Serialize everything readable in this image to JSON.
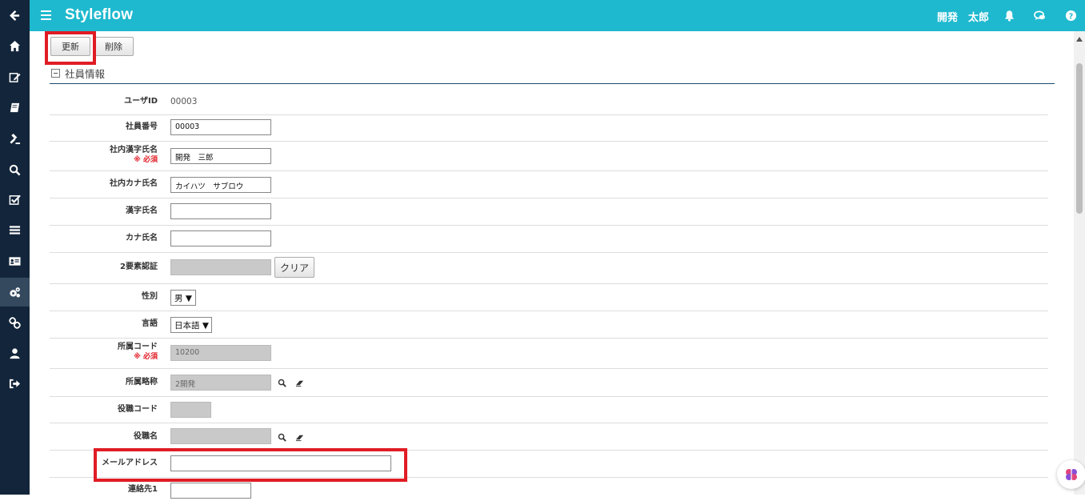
{
  "app": {
    "title": "Styleflow",
    "user_name": "開発　太郎"
  },
  "sidebar": {
    "icons": [
      "back-arrow-icon",
      "home-icon",
      "edit-icon",
      "book-icon",
      "gavel-icon",
      "search-icon",
      "check-icon",
      "list-icon",
      "id-card-icon",
      "gears-icon",
      "link-icon",
      "user-icon",
      "sign-out-icon"
    ],
    "active": "gears-icon"
  },
  "header": {
    "icons": [
      "bell-icon",
      "chat-icon",
      "help-icon"
    ]
  },
  "toolbar": {
    "update_label": "更新",
    "delete_label": "削除"
  },
  "section": {
    "title": "社員情報"
  },
  "form": {
    "user_id": {
      "label": "ユーザID",
      "value": "00003"
    },
    "employee_no": {
      "label": "社員番号",
      "value": "00003"
    },
    "kanji_name_internal": {
      "label": "社内漢字氏名",
      "required": "※ 必須",
      "value": "開発　三郎"
    },
    "kana_name_internal": {
      "label": "社内カナ氏名",
      "value": "カイハツ　サブロウ"
    },
    "kanji_name": {
      "label": "漢字氏名",
      "value": ""
    },
    "kana_name": {
      "label": "カナ氏名",
      "value": ""
    },
    "two_factor": {
      "label": "2要素認証",
      "value": "",
      "clear_label": "クリア"
    },
    "gender": {
      "label": "性別",
      "value": "男"
    },
    "language": {
      "label": "言語",
      "value": "日本語"
    },
    "dept_code": {
      "label": "所属コード",
      "required": "※ 必須",
      "value": "10200"
    },
    "dept_short": {
      "label": "所属略称",
      "value": "2開発"
    },
    "position_code": {
      "label": "役職コード",
      "value": ""
    },
    "position_name": {
      "label": "役職名",
      "value": ""
    },
    "email": {
      "label": "メールアドレス",
      "value": ""
    },
    "contact1": {
      "label": "連絡先1",
      "value": ""
    }
  },
  "colors": {
    "header": "#1eb9cf",
    "sidebar": "#13253a",
    "highlight": "#e01c24",
    "required": "#e01c24"
  }
}
